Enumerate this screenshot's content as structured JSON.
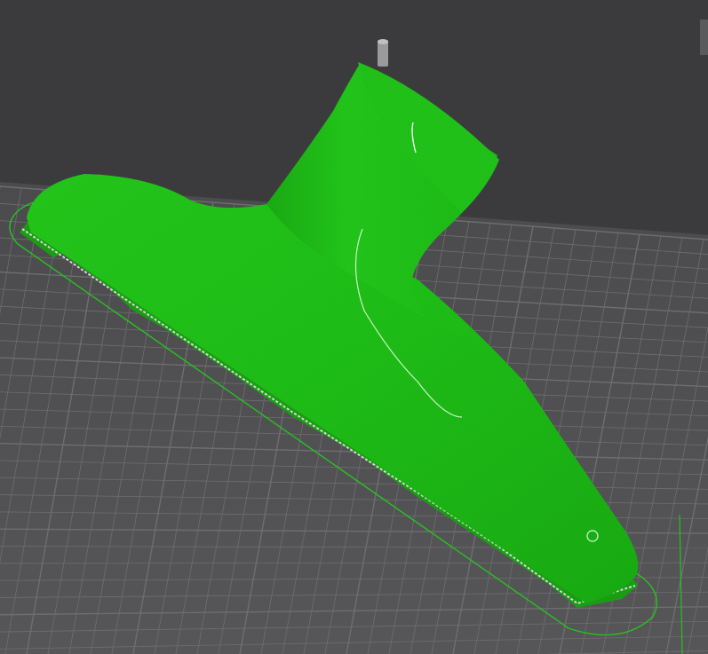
{
  "viewport": {
    "background_color": "#3b3b3d",
    "bed_color": "#4e4e50",
    "grid_color": "#6e6e70",
    "model_color": "#1fbf17",
    "model_shadow_color": "#149a10",
    "skirt_color": "#27c21f",
    "brim_highlight_color": "#d8d8d8"
  },
  "icons": {
    "nozzle": "nozzle-icon",
    "view_widget": "view-widget-icon"
  }
}
